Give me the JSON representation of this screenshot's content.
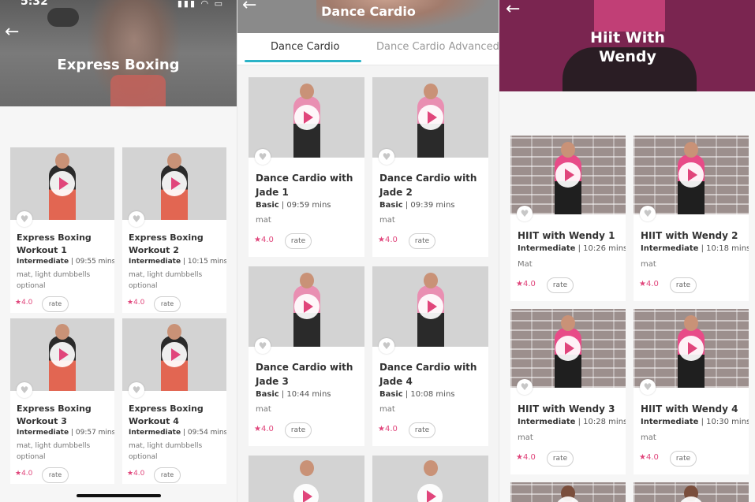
{
  "panel1": {
    "status_time": "5:32",
    "status_icons": "▮▮▮ ◠ ▭",
    "back": "←",
    "title": "Express Boxing",
    "cards": [
      {
        "title1": "Express Boxing",
        "title2": "Workout 1",
        "level": "Intermediate",
        "duration": "| 09:55 mins",
        "equip1": "mat, light dumbbells",
        "equip2": "optional",
        "rating": "★4.0",
        "rate": "rate"
      },
      {
        "title1": "Express Boxing",
        "title2": "Workout 2",
        "level": "Intermediate",
        "duration": "| 10:15 mins",
        "equip1": "mat, light dumbbells",
        "equip2": "optional",
        "rating": "★4.0",
        "rate": "rate"
      },
      {
        "title1": "Express Boxing",
        "title2": "Workout 3",
        "level": "Intermediate",
        "duration": "| 09:57 mins",
        "equip1": "mat, light dumbbells",
        "equip2": "optional",
        "rating": "★4.0",
        "rate": "rate"
      },
      {
        "title1": "Express Boxing",
        "title2": "Workout 4",
        "level": "Intermediate",
        "duration": "| 09:54 mins",
        "equip1": "mat, light dumbbells",
        "equip2": "optional",
        "rating": "★4.0",
        "rate": "rate"
      }
    ]
  },
  "panel2": {
    "back": "←",
    "title": "Dance Cardio",
    "tabs": [
      "Dance Cardio",
      "Dance Cardio Advanced"
    ],
    "cards": [
      {
        "title1": "Dance Cardio with",
        "title2": "Jade 1",
        "level": "Basic",
        "duration": "| 09:59 mins",
        "equip": "mat",
        "rating": "★4.0",
        "rate": "rate"
      },
      {
        "title1": "Dance Cardio with",
        "title2": "Jade 2",
        "level": "Basic",
        "duration": "| 09:39 mins",
        "equip": "mat",
        "rating": "★4.0",
        "rate": "rate"
      },
      {
        "title1": "Dance Cardio with",
        "title2": "Jade 3",
        "level": "Basic",
        "duration": "| 10:44 mins",
        "equip": "mat",
        "rating": "★4.0",
        "rate": "rate"
      },
      {
        "title1": "Dance Cardio with",
        "title2": "Jade 4",
        "level": "Basic",
        "duration": "| 10:08 mins",
        "equip": "mat",
        "rating": "★4.0",
        "rate": "rate"
      }
    ]
  },
  "panel3": {
    "back": "←",
    "title1": "Hiit With",
    "title2": "Wendy",
    "cards": [
      {
        "title": "HIIT with Wendy 1",
        "level": "Intermediate",
        "duration": "| 10:26 mins",
        "equip": "Mat",
        "rating": "★4.0",
        "rate": "rate"
      },
      {
        "title": "HIIT with Wendy 2",
        "level": "Intermediate",
        "duration": "| 10:18 mins",
        "equip": "mat",
        "rating": "★4.0",
        "rate": "rate"
      },
      {
        "title": "HIIT with Wendy 3",
        "level": "Intermediate",
        "duration": "| 10:28 mins",
        "equip": "mat",
        "rating": "★4.0",
        "rate": "rate"
      },
      {
        "title": "HIIT with Wendy 4",
        "level": "Intermediate",
        "duration": "| 10:30 mins",
        "equip": "mat",
        "rating": "★4.0",
        "rate": "rate"
      }
    ]
  },
  "colors": {
    "accent": "#e0457b",
    "tab_underline": "#2bb3c7",
    "hiit_header": "#7a2550"
  }
}
